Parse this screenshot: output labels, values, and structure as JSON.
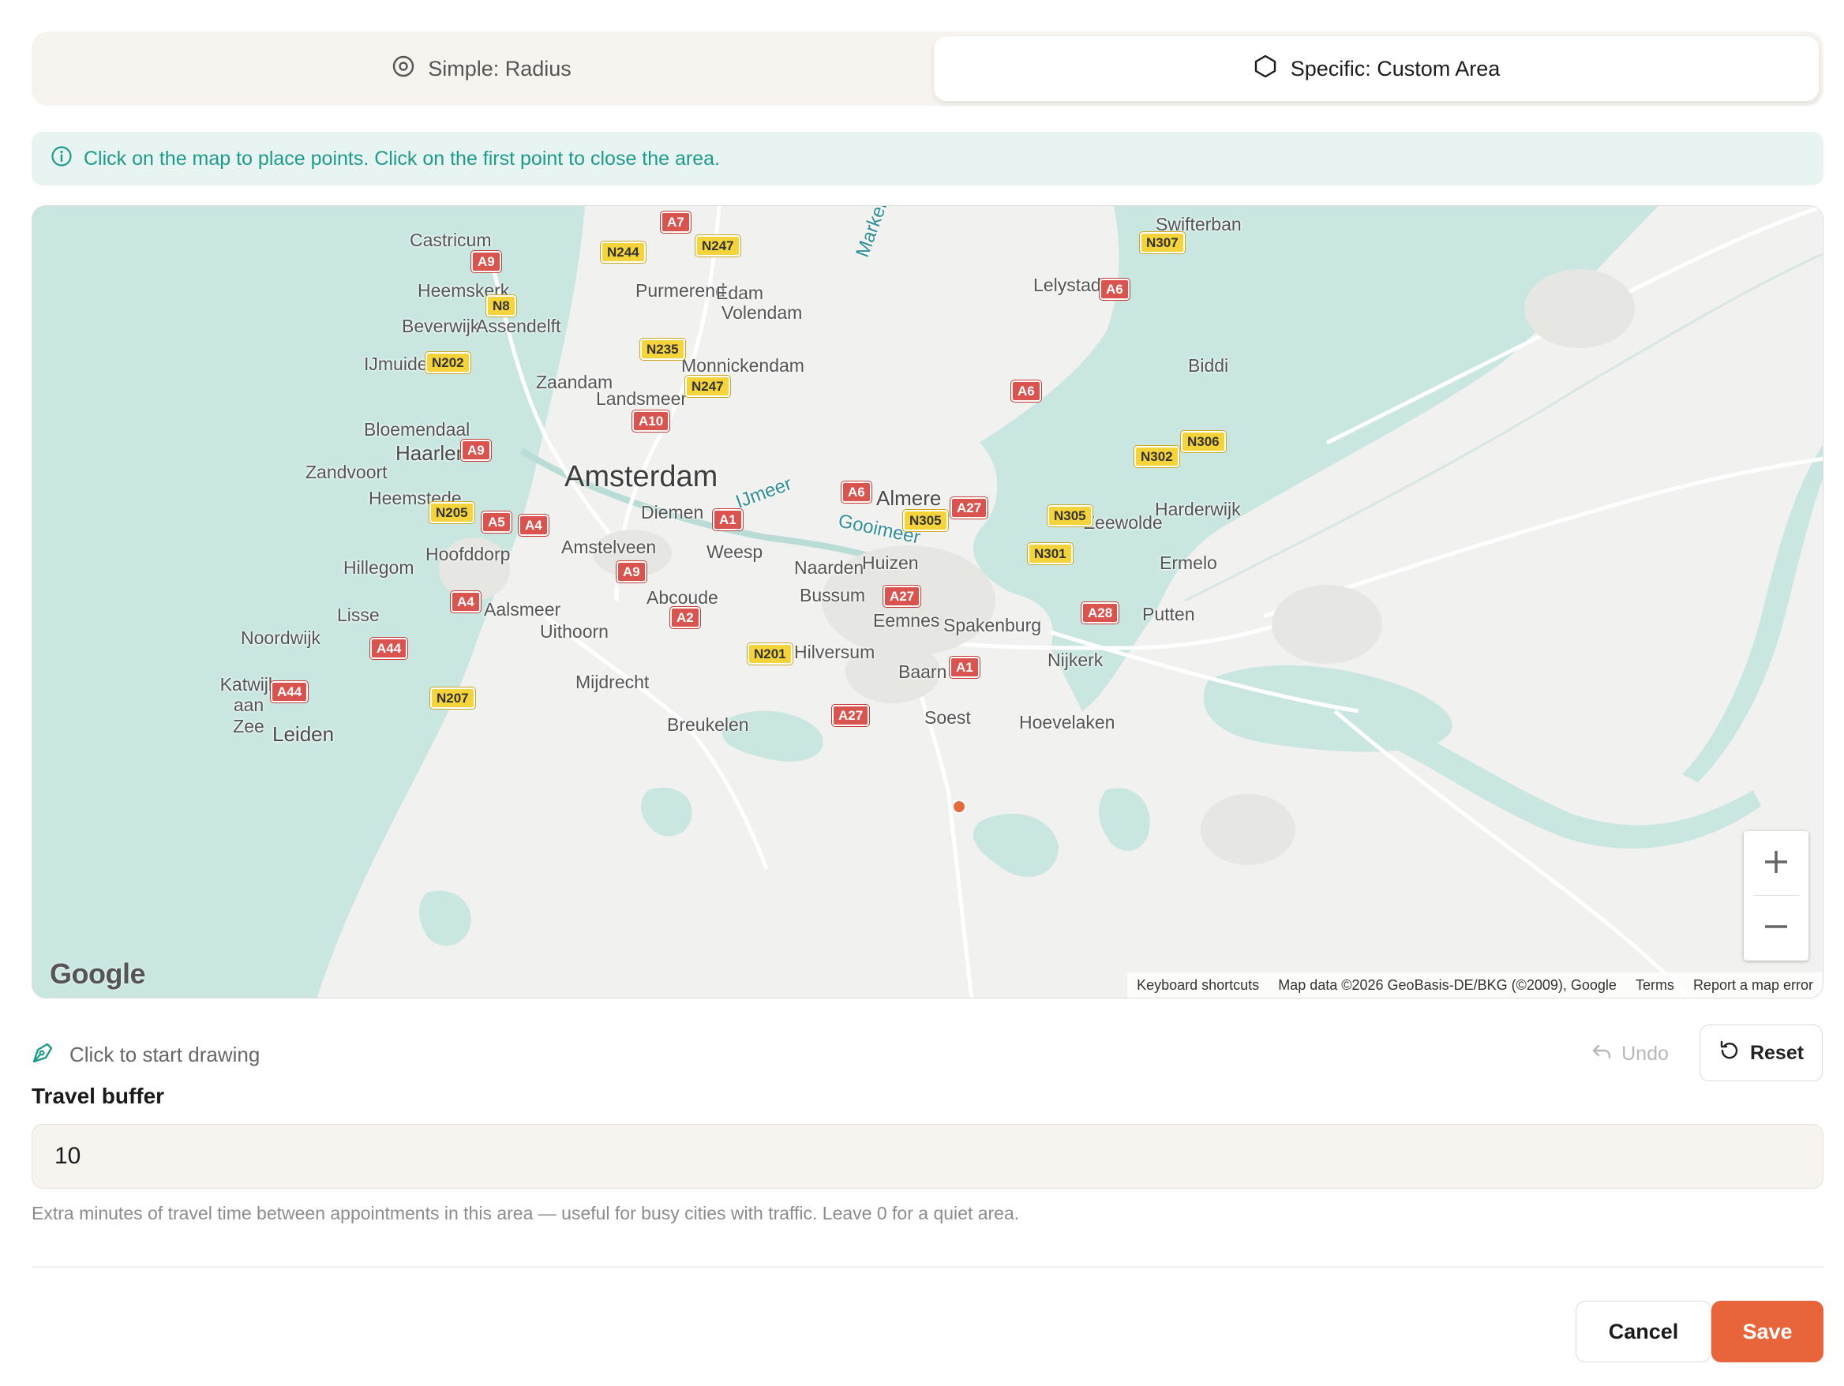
{
  "mode_tabs": [
    {
      "label": "Simple: Radius",
      "icon": "radius-target-icon",
      "active": false
    },
    {
      "label": "Specific: Custom Area",
      "icon": "hexagon-icon",
      "active": true
    }
  ],
  "info_banner": {
    "icon": "info-icon",
    "text": "Click on the map to place points. Click on the first point to close the area."
  },
  "map": {
    "places": [
      "Castricum",
      "Heemskerk",
      "Beverwijk",
      "Assendelft",
      "IJmuiden",
      "Purmerend",
      "Edam",
      "Volendam",
      "Monnickendam",
      "Zaandam",
      "Landsmeer",
      "Bloemendaal",
      "Haarlem",
      "Zandvoort",
      "Heemstede",
      "Amsterdam",
      "Diemen",
      "Almere",
      "Hoofddorp",
      "Amstelveen",
      "Weesp",
      "Naarden",
      "Huizen",
      "Hillegom",
      "Abcoude",
      "Bussum",
      "Lisse",
      "Aalsmeer",
      "Eemnes",
      "Spakenburg",
      "Noordwijk",
      "Uithoorn",
      "Hilversum",
      "Katwijk aan Zee",
      "Mijdrecht",
      "Baarn",
      "Nijkerk",
      "Leiden",
      "Breukelen",
      "Soest",
      "Hoevelaken",
      "Lelystad",
      "Swifterban",
      "Biddi",
      "Harderwijk",
      "Zeewolde",
      "Ermelo",
      "Putten"
    ],
    "water": [
      "Markermeer",
      "IJmeer",
      "Gooimeer"
    ],
    "roads": [
      "A7",
      "A9",
      "N244",
      "N247",
      "N8",
      "N235",
      "N202",
      "N247",
      "A10",
      "A9",
      "A6",
      "N205",
      "A5",
      "A4",
      "A1",
      "A9",
      "N305",
      "A27",
      "A4",
      "A2",
      "A27",
      "A44",
      "N201",
      "A1",
      "A44",
      "N207",
      "A27",
      "N307",
      "A6",
      "A6",
      "N306",
      "N302",
      "N305",
      "N301",
      "A28"
    ],
    "zoom_in_icon": "plus-icon",
    "zoom_out_icon": "minus-icon",
    "logo": "Google",
    "footer": {
      "shortcuts": "Keyboard shortcuts",
      "attribution": "Map data ©2026 GeoBasis-DE/BKG (©2009), Google",
      "terms": "Terms",
      "report": "Report a map error"
    }
  },
  "drawing": {
    "hint": "Click to start drawing",
    "hint_icon": "pen-tool-icon",
    "undo_label": "Undo",
    "reset_label": "Reset"
  },
  "travel_buffer": {
    "label": "Travel buffer",
    "value": "10",
    "help": "Extra minutes of travel time between appointments in this area — useful for busy cities with traffic. Leave 0 for a quiet area."
  },
  "actions": {
    "cancel_label": "Cancel",
    "save_label": "Save"
  },
  "colors": {
    "accent": "#e8643a",
    "teal": "#1e9a8a",
    "water": "#c9e6e1"
  }
}
